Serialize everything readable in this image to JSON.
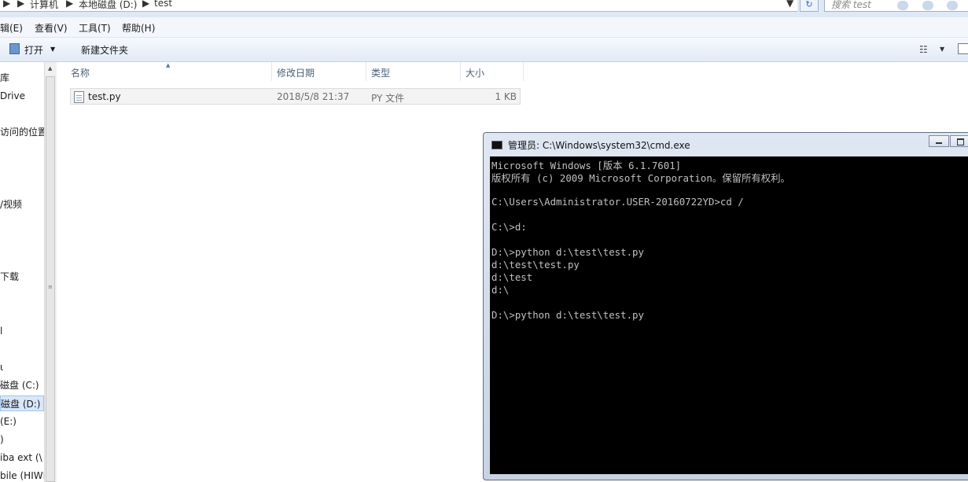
{
  "address": {
    "crumbs": [
      "计算机",
      "本地磁盘 (D:)",
      "test"
    ],
    "search_placeholder": "搜索 test"
  },
  "menu": {
    "edit": "辑(E)",
    "view": "查看(V)",
    "tools": "工具(T)",
    "help": "帮助(H)"
  },
  "toolbar": {
    "open_label": "打开",
    "new_folder_label": "新建文件夹"
  },
  "nav": {
    "items": [
      "库",
      "Drive",
      "访问的位置",
      "/视频",
      "下载",
      "l",
      "ι",
      "磁盘 (C:)",
      "磁盘 (D:)",
      "(E:)",
      ")",
      "iba ext (\\",
      "bile (HIWI"
    ],
    "selected_index": 8
  },
  "columns": {
    "name": "名称",
    "date": "修改日期",
    "type": "类型",
    "size": "大小"
  },
  "files": [
    {
      "name": "test.py",
      "date": "2018/5/8 21:37",
      "type": "PY 文件",
      "size": "1 KB"
    }
  ],
  "cmd": {
    "title": "管理员: C:\\Windows\\system32\\cmd.exe",
    "lines": [
      "Microsoft Windows [版本 6.1.7601]",
      "版权所有 (c) 2009 Microsoft Corporation。保留所有权利。",
      "",
      "C:\\Users\\Administrator.USER-20160722YD>cd /",
      "",
      "C:\\>d:",
      "",
      "D:\\>python d:\\test\\test.py",
      "d:\\test\\test.py",
      "d:\\test",
      "d:\\",
      "",
      "D:\\>python d:\\test\\test.py"
    ]
  },
  "colors": {
    "console_bg": "#000000",
    "console_text": "#c0c0c0",
    "selection": "#d9e8f9"
  }
}
